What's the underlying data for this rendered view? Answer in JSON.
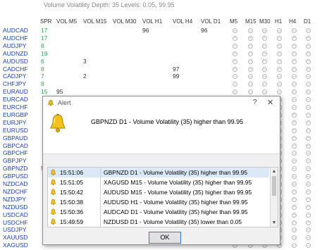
{
  "header": "Volume Volatility Depth: 35    Levels: 0.05, 99.95",
  "columns": [
    "SPR",
    "VOL M5",
    "VOL M15",
    "VOL M30",
    "VOL H1",
    "VOL H4",
    "VOL D1",
    "M5",
    "M15",
    "M30",
    "H1",
    "H4",
    "D1"
  ],
  "colors": {
    "symbol": "#1a3fb8",
    "spread_green": "#2fa84f",
    "spread_red": "#d42020"
  },
  "rows": [
    {
      "symbol": "AUDCAD",
      "spr": "17",
      "spr_color": "green",
      "vals": {
        "h1": "96",
        "d1": "96"
      }
    },
    {
      "symbol": "AUDCHF",
      "spr": "17",
      "spr_color": "green",
      "vals": {}
    },
    {
      "symbol": "AUDJPY",
      "spr": "8",
      "spr_color": "green",
      "vals": {}
    },
    {
      "symbol": "AUDNZD",
      "spr": "19",
      "spr_color": "green",
      "vals": {}
    },
    {
      "symbol": "AUDUSD",
      "spr": "6",
      "spr_color": "green",
      "vals": {
        "m15": "3"
      }
    },
    {
      "symbol": "CADCHF",
      "spr": "8",
      "spr_color": "green",
      "vals": {
        "h4": "97"
      }
    },
    {
      "symbol": "CADJPY",
      "spr": "7",
      "spr_color": "green",
      "vals": {
        "m15": "2",
        "h4": "99"
      }
    },
    {
      "symbol": "CHFJPY",
      "spr": "8",
      "spr_color": "green",
      "vals": {}
    },
    {
      "symbol": "EURAUD",
      "spr": "15",
      "spr_color": "green",
      "vals": {
        "m5": "95"
      }
    },
    {
      "symbol": "EURCAD",
      "spr": "",
      "spr_color": "green",
      "vals": {}
    },
    {
      "symbol": "EURCHF",
      "spr": "",
      "spr_color": "green",
      "vals": {}
    },
    {
      "symbol": "EURGBP",
      "spr": "",
      "spr_color": "green",
      "vals": {}
    },
    {
      "symbol": "EURJPY",
      "spr": "",
      "spr_color": "green",
      "vals": {}
    },
    {
      "symbol": "EURUSD",
      "spr": "",
      "spr_color": "green",
      "vals": {}
    },
    {
      "symbol": "GBPAUD",
      "spr": "",
      "spr_color": "green",
      "vals": {}
    },
    {
      "symbol": "GBPCAD",
      "spr": "",
      "spr_color": "green",
      "vals": {}
    },
    {
      "symbol": "GBPCHF",
      "spr": "",
      "spr_color": "green",
      "vals": {}
    },
    {
      "symbol": "GBPJPY",
      "spr": "",
      "spr_color": "green",
      "vals": {}
    },
    {
      "symbol": "GBPNZD",
      "spr": "5",
      "spr_color": "red",
      "vals": {}
    },
    {
      "symbol": "GBPUSD",
      "spr": "",
      "spr_color": "green",
      "vals": {}
    },
    {
      "symbol": "NZDCAD",
      "spr": "",
      "spr_color": "green",
      "vals": {}
    },
    {
      "symbol": "NZDCHF",
      "spr": "",
      "spr_color": "green",
      "vals": {}
    },
    {
      "symbol": "NZDJPY",
      "spr": "",
      "spr_color": "green",
      "vals": {}
    },
    {
      "symbol": "NZDUSD",
      "spr": "",
      "spr_color": "green",
      "vals": {}
    },
    {
      "symbol": "USDCAD",
      "spr": "",
      "spr_color": "green",
      "vals": {}
    },
    {
      "symbol": "USDCHF",
      "spr": "",
      "spr_color": "green",
      "vals": {}
    },
    {
      "symbol": "USDJPY",
      "spr": "",
      "spr_color": "green",
      "vals": {}
    },
    {
      "symbol": "XAUUSD",
      "spr": "",
      "spr_color": "green",
      "vals": {}
    },
    {
      "symbol": "XAGUSD",
      "spr": "",
      "spr_color": "green",
      "vals": {}
    }
  ],
  "dialog": {
    "title": "Alert",
    "help": "?",
    "close": "✕",
    "message": "GBPNZD D1 - Volume Volatility (35) higher than 99.95",
    "icon": "bell-icon",
    "alerts": [
      {
        "time": "15:51:06",
        "msg": "GBPNZD D1 - Volume Volatility (35) higher than 99.95"
      },
      {
        "time": "15:51:05",
        "msg": "XAGUSD M15 - Volume Volatility (35) higher than 99.95"
      },
      {
        "time": "15:50:42",
        "msg": "AUDUSD M15 - Volume Volatility (35) higher than 99.95"
      },
      {
        "time": "15:50:38",
        "msg": "AUDUSD H1 - Volume Volatility (35) higher than 99.95"
      },
      {
        "time": "15:50:36",
        "msg": "AUDCAD D1 - Volume Volatility (35) higher than 99.95"
      },
      {
        "time": "15:49:59",
        "msg": "NZDUSD D1 - Volume Volatility (35) lower than 0.05"
      }
    ],
    "ok_label": "OK"
  }
}
